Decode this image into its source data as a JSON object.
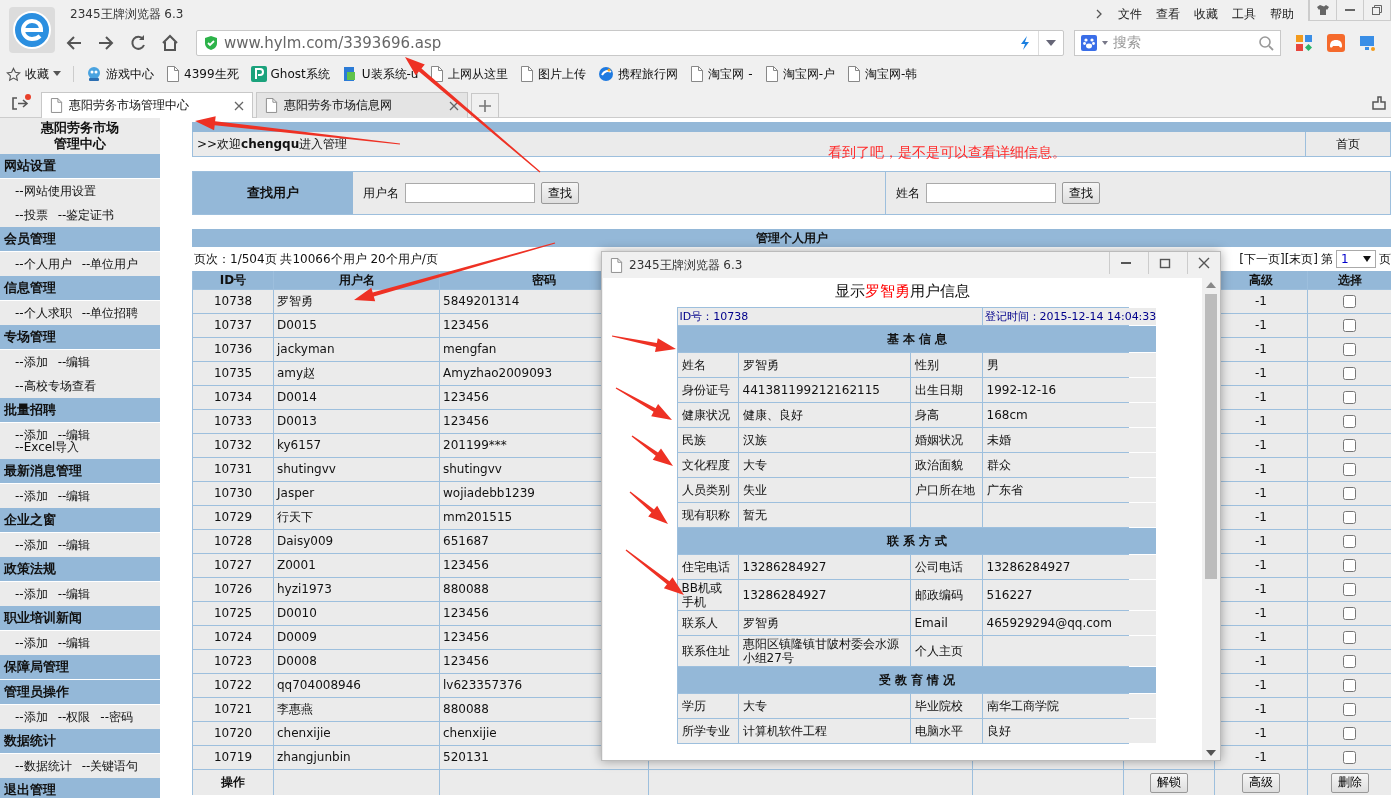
{
  "browser": {
    "title": "2345王牌浏览器 6.3",
    "menu": [
      "文件",
      "查看",
      "收藏",
      "工具",
      "帮助"
    ],
    "url": "www.hylm.com/3393696.asp",
    "search_placeholder": "搜索",
    "favorites_label": "收藏",
    "bookmarks": [
      {
        "label": "游戏中心",
        "kind": "game"
      },
      {
        "label": "4399生死",
        "kind": "page"
      },
      {
        "label": "Ghost系统",
        "kind": "ghost"
      },
      {
        "label": "U装系统-u",
        "kind": "usys"
      },
      {
        "label": "上网从这里",
        "kind": "page"
      },
      {
        "label": "图片上传",
        "kind": "page"
      },
      {
        "label": "携程旅行网",
        "kind": "ctrip"
      },
      {
        "label": "淘宝网 -",
        "kind": "page"
      },
      {
        "label": "淘宝网-户",
        "kind": "page"
      },
      {
        "label": "淘宝网-韩",
        "kind": "page"
      }
    ],
    "tabs": [
      {
        "label": "惠阳劳务市场管理中心",
        "selected": true
      },
      {
        "label": "惠阳劳务市场信息网",
        "selected": false
      }
    ]
  },
  "sidebar": {
    "title": "惠阳劳务市场管理中心",
    "sections": [
      {
        "title": "网站设置",
        "lines": [
          [
            "--网站使用设置"
          ],
          [
            "--投票",
            "--鉴定证书"
          ]
        ]
      },
      {
        "title": "会员管理",
        "lines": [
          [
            "--个人用户",
            "--单位用户"
          ]
        ]
      },
      {
        "title": "信息管理",
        "lines": [
          [
            "--个人求职",
            "--单位招聘"
          ]
        ]
      },
      {
        "title": "专场管理",
        "lines": [
          [
            "--添加",
            "--编辑"
          ],
          [
            "--高校专场查看"
          ]
        ]
      },
      {
        "title": "批量招聘",
        "lines": [
          [
            "--添加",
            "--编辑"
          ],
          [
            "--Excel导入"
          ]
        ]
      },
      {
        "title": "最新消息管理",
        "lines": [
          [
            "--添加",
            "--编辑"
          ]
        ]
      },
      {
        "title": "企业之窗",
        "lines": [
          [
            "--添加",
            "--编辑"
          ]
        ]
      },
      {
        "title": "政策法规",
        "lines": [
          [
            "--添加",
            "--编辑"
          ]
        ]
      },
      {
        "title": "职业培训新闻",
        "lines": [
          [
            "--添加",
            "--编辑"
          ]
        ]
      },
      {
        "title": "保障局管理"
      },
      {
        "title": "管理员操作",
        "lines": [
          [
            "--添加",
            "--权限",
            "--密码"
          ]
        ]
      },
      {
        "title": "数据统计",
        "lines": [
          [
            "--数据统计",
            "--关键语句"
          ]
        ]
      },
      {
        "title": "退出管理"
      }
    ]
  },
  "welcome": ">>欢迎**chengqu**进入管理",
  "home_link": "首页",
  "annotation": "看到了吧，是不是可以查看详细信息。",
  "search": {
    "label": "查找用户",
    "fields": [
      {
        "label": "用户名",
        "button": "查找"
      },
      {
        "label": "姓名",
        "button": "查找"
      }
    ]
  },
  "user_table": {
    "title": "管理个人用户",
    "paging": "页次：1/504页 共10066个用户 20个用户/页",
    "page_nav": "[下一页][末页]",
    "page_prefix": "第",
    "page_value": "1",
    "page_suffix": "页",
    "columns": [
      "ID号",
      "用户名",
      "密码",
      "高级",
      "选择"
    ],
    "rows": [
      {
        "id": "10738",
        "user": "罗智勇",
        "password": "5849201314",
        "level": "-1",
        "checked": false
      },
      {
        "id": "10737",
        "user": "D0015",
        "password": "123456",
        "level": "-1",
        "checked": false
      },
      {
        "id": "10736",
        "user": "jackyman",
        "password": "mengfan",
        "level": "-1",
        "checked": false
      },
      {
        "id": "10735",
        "user": "amy赵",
        "password": "Amyzhao2009093",
        "level": "-1",
        "checked": false
      },
      {
        "id": "10734",
        "user": "D0014",
        "password": "123456",
        "level": "-1",
        "checked": false
      },
      {
        "id": "10733",
        "user": "D0013",
        "password": "123456",
        "level": "-1",
        "checked": false
      },
      {
        "id": "10732",
        "user": "ky6157",
        "password": "201199***",
        "level": "-1",
        "checked": false
      },
      {
        "id": "10731",
        "user": "shutingvv",
        "password": "shutingvv",
        "level": "-1",
        "checked": false
      },
      {
        "id": "10730",
        "user": "Jasper",
        "password": "wojiadebb1239",
        "level": "-1",
        "checked": false
      },
      {
        "id": "10729",
        "user": "行天下",
        "password": "mm201515",
        "level": "-1",
        "checked": false
      },
      {
        "id": "10728",
        "user": "Daisy009",
        "password": "651687",
        "level": "-1",
        "checked": false
      },
      {
        "id": "10727",
        "user": "Z0001",
        "password": "123456",
        "level": "-1",
        "checked": false
      },
      {
        "id": "10726",
        "user": "hyzi1973",
        "password": "880088",
        "level": "-1",
        "checked": false
      },
      {
        "id": "10725",
        "user": "D0010",
        "password": "123456",
        "level": "-1",
        "checked": false
      },
      {
        "id": "10724",
        "user": "D0009",
        "password": "123456",
        "level": "-1",
        "checked": false
      },
      {
        "id": "10723",
        "user": "D0008",
        "password": "123456",
        "level": "-1",
        "checked": false
      },
      {
        "id": "10722",
        "user": "qq704008946",
        "password": "lv623357376",
        "level": "-1",
        "checked": false
      },
      {
        "id": "10721",
        "user": "李惠燕",
        "password": "880088",
        "level": "-1",
        "checked": false
      },
      {
        "id": "10720",
        "user": "chenxijie",
        "password": "chenxijie",
        "level": "-1",
        "checked": false
      },
      {
        "id": "10719",
        "user": "zhangjunbin",
        "password": "520131",
        "level": "-1",
        "checked": false
      }
    ],
    "footer_label": "操作",
    "actions": [
      "解锁",
      "高级",
      "删除"
    ]
  },
  "popup": {
    "title": "2345王牌浏览器 6.3",
    "heading_prefix": "显示",
    "heading_name": "罗智勇",
    "heading_suffix": "用户信息",
    "id_text": "ID号：10738",
    "reg_text": "登记时间：2015-12-14 14:04:33",
    "sections": [
      {
        "title": "基 本 信 息",
        "rows": [
          [
            "姓名",
            "罗智勇",
            "性别",
            "男"
          ],
          [
            "身份证号",
            "441381199212162115",
            "出生日期",
            "1992-12-16"
          ],
          [
            "健康状况",
            "健康、良好",
            "身高",
            "168cm"
          ],
          [
            "民族",
            "汉族",
            "婚姻状况",
            "未婚"
          ],
          [
            "文化程度",
            "大专",
            "政治面貌",
            "群众"
          ],
          [
            "人员类别",
            "失业",
            "户口所在地",
            "广东省"
          ],
          [
            "现有职称",
            "暂无",
            null,
            null
          ]
        ]
      },
      {
        "title": "联 系 方 式",
        "rows": [
          [
            "住宅电话",
            "13286284927",
            "公司电话",
            "13286284927"
          ],
          [
            "BB机或手机",
            "13286284927",
            "邮政编码",
            "516227"
          ],
          [
            "联系人",
            "罗智勇",
            "Email",
            "465929294@qq.com"
          ],
          [
            "联系住址",
            "惠阳区镇隆镇甘陂村委会水源小组27号",
            "个人主页",
            null
          ]
        ]
      },
      {
        "title": "受 教 育 情 况",
        "rows": [
          [
            "学历",
            "大专",
            "毕业院校",
            "南华工商学院"
          ],
          [
            "所学专业",
            "计算机软件工程",
            "电脑水平",
            "良好"
          ]
        ]
      }
    ]
  }
}
